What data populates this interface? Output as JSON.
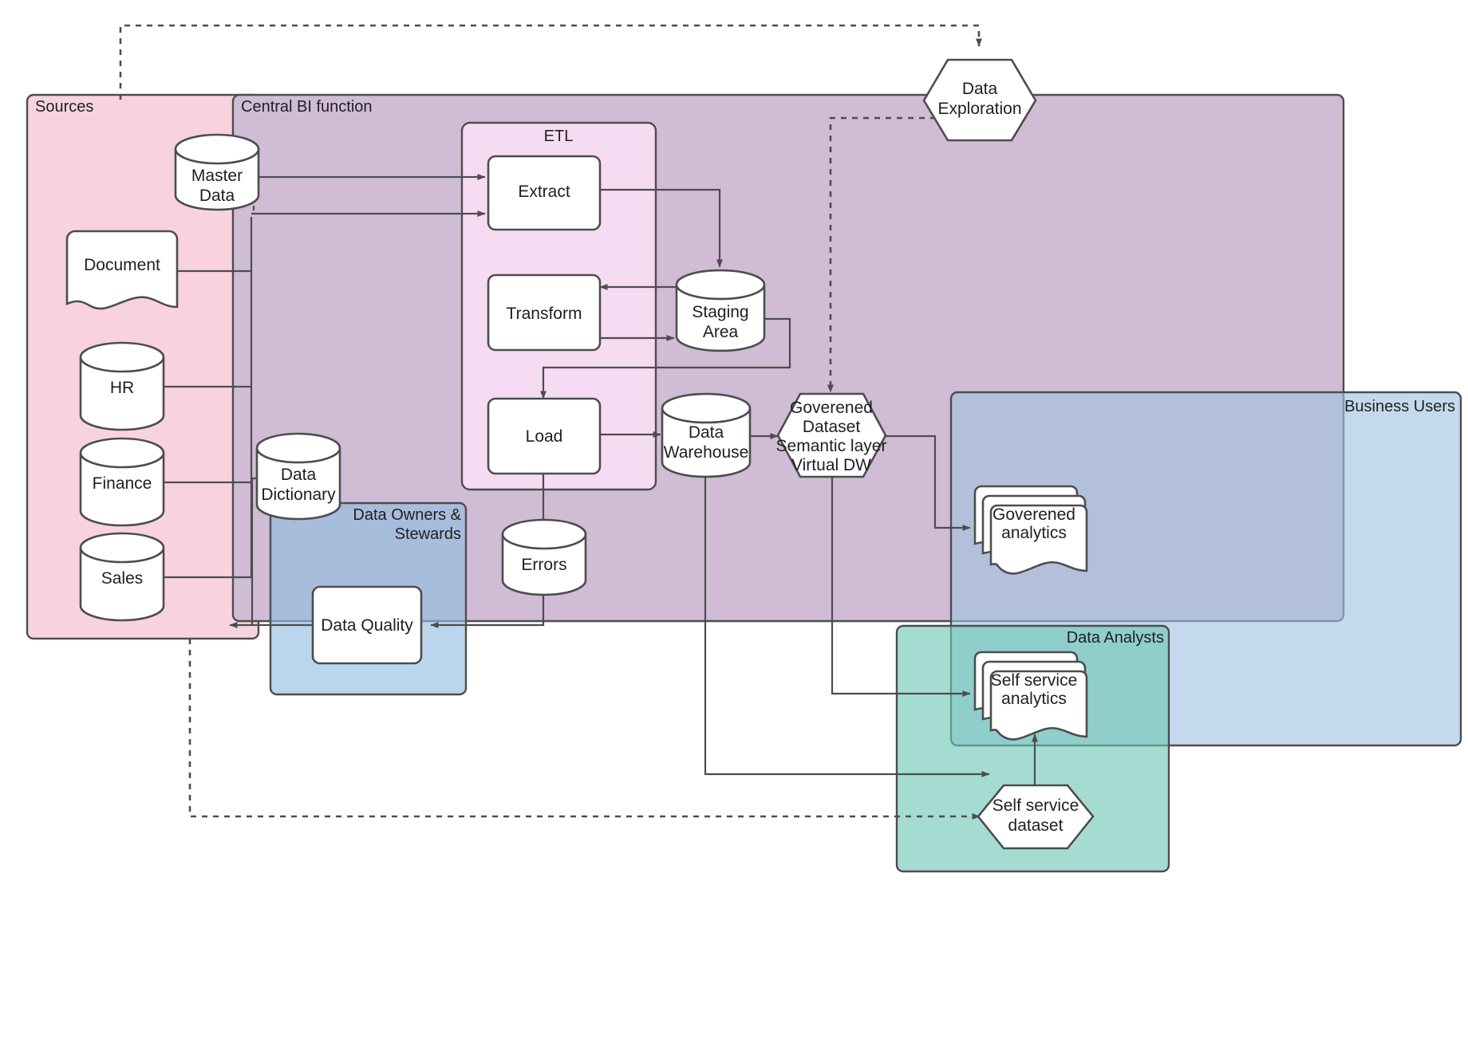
{
  "diagram": {
    "title": "BI Data Architecture Flow",
    "groups": [
      {
        "id": "sources",
        "label": "Sources",
        "color": "#f8d3de",
        "opacity": 1.0,
        "label_anchor": "start"
      },
      {
        "id": "central_bi",
        "label": "Central BI function",
        "color": "#d0bcd5",
        "opacity": 1.0,
        "label_anchor": "start"
      },
      {
        "id": "etl",
        "label": "ETL",
        "color": "#f6dcf2",
        "opacity": 1.0,
        "label_anchor": "middle"
      },
      {
        "id": "data_owners",
        "label": "Data Owners & Stewards",
        "color": "#cde5f5",
        "opacity": 0.92,
        "label_anchor": "end"
      },
      {
        "id": "business_users",
        "label": "Business Users",
        "color": "#cbe6f5",
        "opacity": 0.8,
        "label_anchor": "end"
      },
      {
        "id": "data_analysts",
        "label": "Data Analysts",
        "color": "#a8ddd0",
        "opacity": 0.85,
        "label_anchor": "end"
      }
    ],
    "nodes": [
      {
        "id": "master_data",
        "label": "Master Data",
        "shape": "cylinder"
      },
      {
        "id": "document",
        "label": "Document",
        "shape": "document"
      },
      {
        "id": "hr",
        "label": "HR",
        "shape": "cylinder"
      },
      {
        "id": "finance",
        "label": "Finance",
        "shape": "cylinder"
      },
      {
        "id": "sales",
        "label": "Sales",
        "shape": "cylinder"
      },
      {
        "id": "data_dictionary",
        "label": "Data Dictionary",
        "shape": "cylinder"
      },
      {
        "id": "extract",
        "label": "Extract",
        "shape": "rounded-rect"
      },
      {
        "id": "transform",
        "label": "Transform",
        "shape": "rounded-rect"
      },
      {
        "id": "load",
        "label": "Load",
        "shape": "rounded-rect"
      },
      {
        "id": "staging_area",
        "label": "Staging Area",
        "shape": "cylinder"
      },
      {
        "id": "data_warehouse",
        "label": "Data Warehouse",
        "shape": "cylinder"
      },
      {
        "id": "errors",
        "label": "Errors",
        "shape": "cylinder"
      },
      {
        "id": "data_quality",
        "label": "Data Quality",
        "shape": "rounded-rect"
      },
      {
        "id": "governed_ds",
        "label": "Goverened Dataset Semantic layer Virtual DW",
        "shape": "hexagon"
      },
      {
        "id": "data_expl",
        "label": "Data Exploration",
        "shape": "hexagon"
      },
      {
        "id": "governed_an",
        "label": "Goverened analytics",
        "shape": "multi-document"
      },
      {
        "id": "selfserv_an",
        "label": "Self service analytics",
        "shape": "multi-document"
      },
      {
        "id": "selfserv_ds",
        "label": "Self service dataset",
        "shape": "hexagon"
      }
    ],
    "node_labels": {
      "master_data": [
        "Master",
        "Data"
      ],
      "document": [
        "Document"
      ],
      "hr": [
        "HR"
      ],
      "finance": [
        "Finance"
      ],
      "sales": [
        "Sales"
      ],
      "data_dictionary": [
        "Data",
        "Dictionary"
      ],
      "extract": [
        "Extract"
      ],
      "transform": [
        "Transform"
      ],
      "load": [
        "Load"
      ],
      "staging_area": [
        "Staging",
        "Area"
      ],
      "data_warehouse": [
        "Data",
        "Warehouse"
      ],
      "errors": [
        "Errors"
      ],
      "data_quality": [
        "Data Quality"
      ],
      "governed_ds": [
        "Goverened",
        "Dataset",
        "Semantic layer",
        "Virtual DW"
      ],
      "data_expl": [
        "Data",
        "Exploration"
      ],
      "governed_an": [
        "Goverened",
        "analytics"
      ],
      "selfserv_an": [
        "Self service",
        "analytics"
      ],
      "selfserv_ds": [
        "Self service",
        "dataset"
      ]
    },
    "group_labels": {
      "sources": [
        "Sources"
      ],
      "central_bi": [
        "Central BI function"
      ],
      "etl": [
        "ETL"
      ],
      "data_owners": [
        "Data Owners &",
        "Stewards"
      ],
      "business_users": [
        "Business Users"
      ],
      "data_analysts": [
        "Data Analysts"
      ]
    },
    "edges": [
      {
        "from": "master_data",
        "to": "extract",
        "style": "solid"
      },
      {
        "from": "document",
        "to": "extract",
        "style": "solid"
      },
      {
        "from": "hr",
        "to": "extract",
        "style": "solid"
      },
      {
        "from": "finance",
        "to": "extract",
        "style": "solid"
      },
      {
        "from": "sales",
        "to": "extract",
        "style": "solid"
      },
      {
        "from": "extract",
        "to": "staging_area",
        "style": "solid"
      },
      {
        "from": "staging_area",
        "to": "transform",
        "style": "solid"
      },
      {
        "from": "transform",
        "to": "staging_area",
        "style": "solid"
      },
      {
        "from": "staging_area",
        "to": "load",
        "style": "solid"
      },
      {
        "from": "load",
        "to": "data_warehouse",
        "style": "solid"
      },
      {
        "from": "load",
        "to": "errors",
        "style": "solid"
      },
      {
        "from": "errors",
        "to": "data_quality",
        "style": "solid"
      },
      {
        "from": "data_quality",
        "to": "sources",
        "style": "solid"
      },
      {
        "from": "data_dictionary",
        "to": "data_quality",
        "style": "solid"
      },
      {
        "from": "data_warehouse",
        "to": "governed_ds",
        "style": "solid"
      },
      {
        "from": "governed_ds",
        "to": "governed_an",
        "style": "solid"
      },
      {
        "from": "governed_ds",
        "to": "selfserv_an",
        "style": "solid"
      },
      {
        "from": "data_warehouse",
        "to": "selfserv_ds",
        "style": "solid"
      },
      {
        "from": "selfserv_ds",
        "to": "selfserv_an",
        "style": "solid"
      },
      {
        "from": "sources",
        "to": "data_expl",
        "style": "dotted"
      },
      {
        "from": "data_expl",
        "to": "governed_ds",
        "style": "dotted"
      },
      {
        "from": "sources",
        "to": "selfserv_ds",
        "style": "dotted"
      }
    ],
    "colors": {
      "stroke": "#4d4d4d",
      "node_fill": "#ffffff",
      "text": "#1f1f1f",
      "sources": "#f8d3de",
      "central_bi": "#d0bcd5",
      "etl": "#f6dcf2",
      "data_owners": "#cde5f5",
      "business_users": "#cbe6f5",
      "data_analysts": "#a8ddd0"
    }
  }
}
